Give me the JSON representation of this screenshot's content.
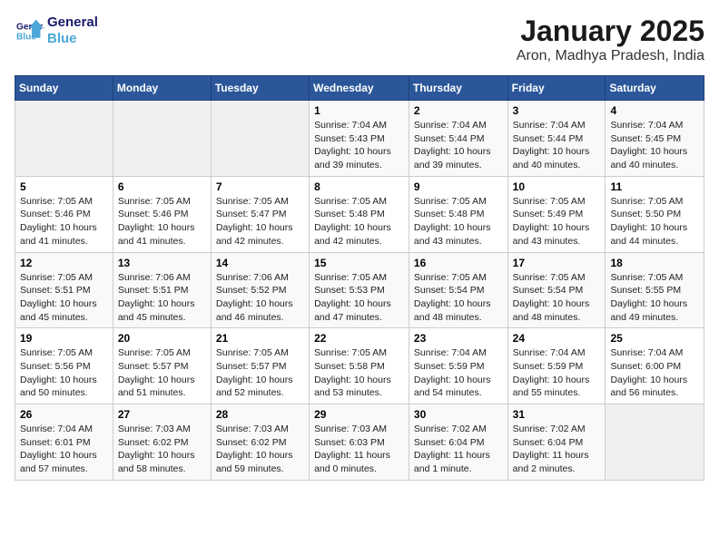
{
  "logo": {
    "line1": "General",
    "line2": "Blue"
  },
  "title": "January 2025",
  "subtitle": "Aron, Madhya Pradesh, India",
  "headers": [
    "Sunday",
    "Monday",
    "Tuesday",
    "Wednesday",
    "Thursday",
    "Friday",
    "Saturday"
  ],
  "weeks": [
    [
      {
        "day": "",
        "info": ""
      },
      {
        "day": "",
        "info": ""
      },
      {
        "day": "",
        "info": ""
      },
      {
        "day": "1",
        "info": "Sunrise: 7:04 AM\nSunset: 5:43 PM\nDaylight: 10 hours\nand 39 minutes."
      },
      {
        "day": "2",
        "info": "Sunrise: 7:04 AM\nSunset: 5:44 PM\nDaylight: 10 hours\nand 39 minutes."
      },
      {
        "day": "3",
        "info": "Sunrise: 7:04 AM\nSunset: 5:44 PM\nDaylight: 10 hours\nand 40 minutes."
      },
      {
        "day": "4",
        "info": "Sunrise: 7:04 AM\nSunset: 5:45 PM\nDaylight: 10 hours\nand 40 minutes."
      }
    ],
    [
      {
        "day": "5",
        "info": "Sunrise: 7:05 AM\nSunset: 5:46 PM\nDaylight: 10 hours\nand 41 minutes."
      },
      {
        "day": "6",
        "info": "Sunrise: 7:05 AM\nSunset: 5:46 PM\nDaylight: 10 hours\nand 41 minutes."
      },
      {
        "day": "7",
        "info": "Sunrise: 7:05 AM\nSunset: 5:47 PM\nDaylight: 10 hours\nand 42 minutes."
      },
      {
        "day": "8",
        "info": "Sunrise: 7:05 AM\nSunset: 5:48 PM\nDaylight: 10 hours\nand 42 minutes."
      },
      {
        "day": "9",
        "info": "Sunrise: 7:05 AM\nSunset: 5:48 PM\nDaylight: 10 hours\nand 43 minutes."
      },
      {
        "day": "10",
        "info": "Sunrise: 7:05 AM\nSunset: 5:49 PM\nDaylight: 10 hours\nand 43 minutes."
      },
      {
        "day": "11",
        "info": "Sunrise: 7:05 AM\nSunset: 5:50 PM\nDaylight: 10 hours\nand 44 minutes."
      }
    ],
    [
      {
        "day": "12",
        "info": "Sunrise: 7:05 AM\nSunset: 5:51 PM\nDaylight: 10 hours\nand 45 minutes."
      },
      {
        "day": "13",
        "info": "Sunrise: 7:06 AM\nSunset: 5:51 PM\nDaylight: 10 hours\nand 45 minutes."
      },
      {
        "day": "14",
        "info": "Sunrise: 7:06 AM\nSunset: 5:52 PM\nDaylight: 10 hours\nand 46 minutes."
      },
      {
        "day": "15",
        "info": "Sunrise: 7:05 AM\nSunset: 5:53 PM\nDaylight: 10 hours\nand 47 minutes."
      },
      {
        "day": "16",
        "info": "Sunrise: 7:05 AM\nSunset: 5:54 PM\nDaylight: 10 hours\nand 48 minutes."
      },
      {
        "day": "17",
        "info": "Sunrise: 7:05 AM\nSunset: 5:54 PM\nDaylight: 10 hours\nand 48 minutes."
      },
      {
        "day": "18",
        "info": "Sunrise: 7:05 AM\nSunset: 5:55 PM\nDaylight: 10 hours\nand 49 minutes."
      }
    ],
    [
      {
        "day": "19",
        "info": "Sunrise: 7:05 AM\nSunset: 5:56 PM\nDaylight: 10 hours\nand 50 minutes."
      },
      {
        "day": "20",
        "info": "Sunrise: 7:05 AM\nSunset: 5:57 PM\nDaylight: 10 hours\nand 51 minutes."
      },
      {
        "day": "21",
        "info": "Sunrise: 7:05 AM\nSunset: 5:57 PM\nDaylight: 10 hours\nand 52 minutes."
      },
      {
        "day": "22",
        "info": "Sunrise: 7:05 AM\nSunset: 5:58 PM\nDaylight: 10 hours\nand 53 minutes."
      },
      {
        "day": "23",
        "info": "Sunrise: 7:04 AM\nSunset: 5:59 PM\nDaylight: 10 hours\nand 54 minutes."
      },
      {
        "day": "24",
        "info": "Sunrise: 7:04 AM\nSunset: 5:59 PM\nDaylight: 10 hours\nand 55 minutes."
      },
      {
        "day": "25",
        "info": "Sunrise: 7:04 AM\nSunset: 6:00 PM\nDaylight: 10 hours\nand 56 minutes."
      }
    ],
    [
      {
        "day": "26",
        "info": "Sunrise: 7:04 AM\nSunset: 6:01 PM\nDaylight: 10 hours\nand 57 minutes."
      },
      {
        "day": "27",
        "info": "Sunrise: 7:03 AM\nSunset: 6:02 PM\nDaylight: 10 hours\nand 58 minutes."
      },
      {
        "day": "28",
        "info": "Sunrise: 7:03 AM\nSunset: 6:02 PM\nDaylight: 10 hours\nand 59 minutes."
      },
      {
        "day": "29",
        "info": "Sunrise: 7:03 AM\nSunset: 6:03 PM\nDaylight: 11 hours\nand 0 minutes."
      },
      {
        "day": "30",
        "info": "Sunrise: 7:02 AM\nSunset: 6:04 PM\nDaylight: 11 hours\nand 1 minute."
      },
      {
        "day": "31",
        "info": "Sunrise: 7:02 AM\nSunset: 6:04 PM\nDaylight: 11 hours\nand 2 minutes."
      },
      {
        "day": "",
        "info": ""
      }
    ]
  ]
}
